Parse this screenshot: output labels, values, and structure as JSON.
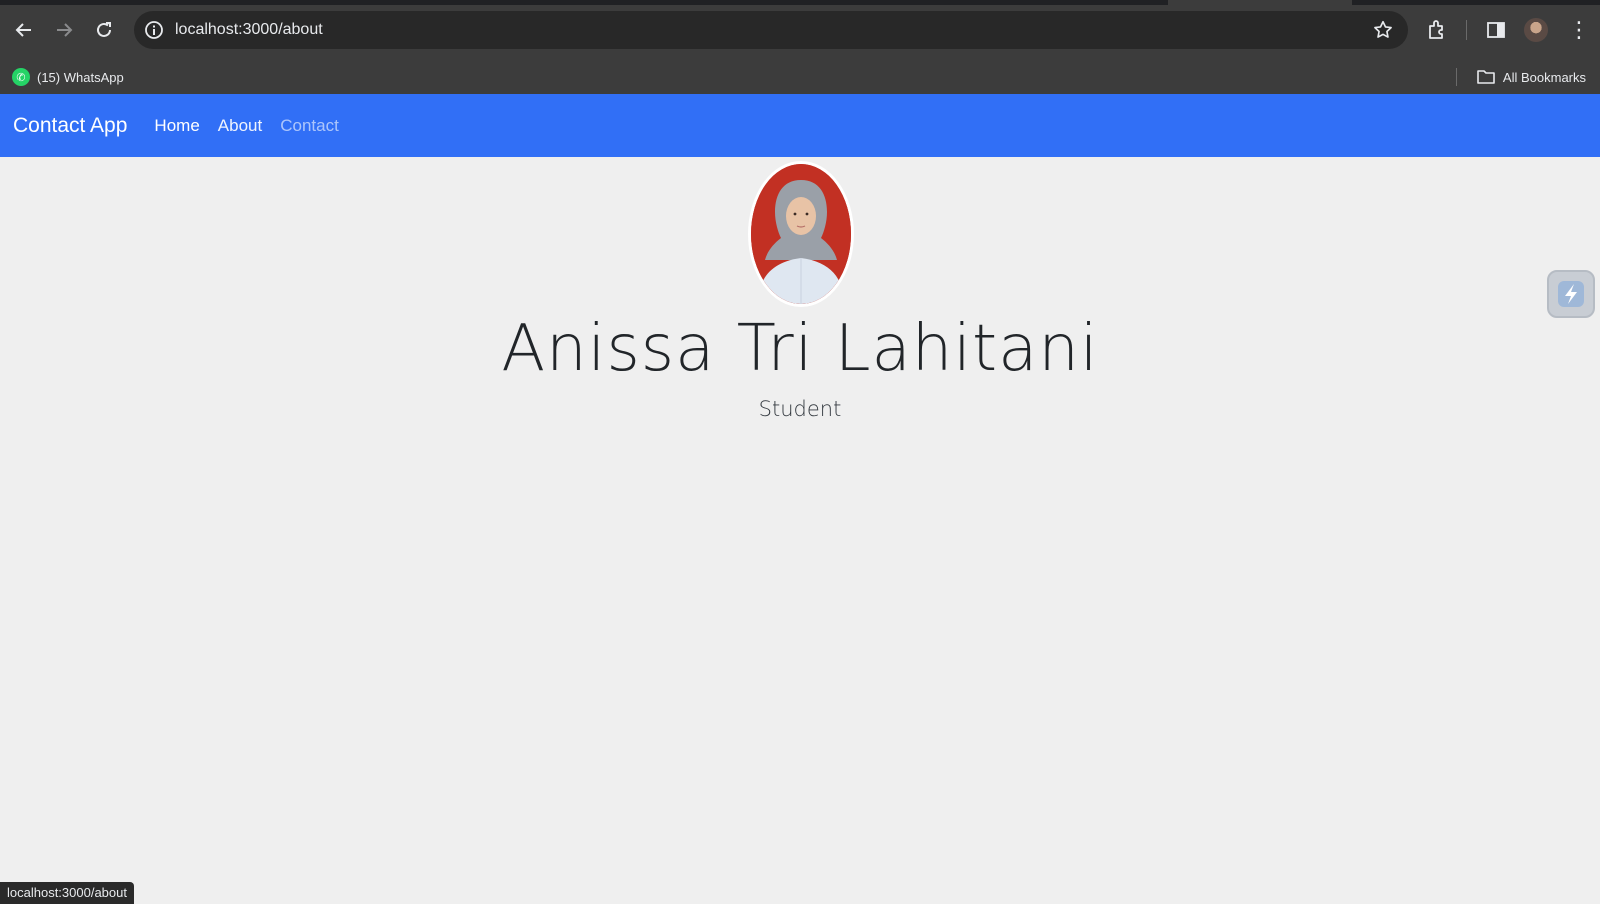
{
  "browser": {
    "url": "localhost:3000/about",
    "bookmarks": [
      {
        "label": "(15) WhatsApp",
        "icon": "whatsapp-icon"
      }
    ],
    "all_bookmarks_label": "All Bookmarks",
    "status_url": "localhost:3000/about"
  },
  "navbar": {
    "brand": "Contact App",
    "links": [
      {
        "label": "Home"
      },
      {
        "label": "About"
      },
      {
        "label": "Contact"
      }
    ],
    "color": "#316ff6"
  },
  "profile": {
    "name": "Anissa Tri Lahitani",
    "role": "Student",
    "photo_background": "#c23023"
  }
}
